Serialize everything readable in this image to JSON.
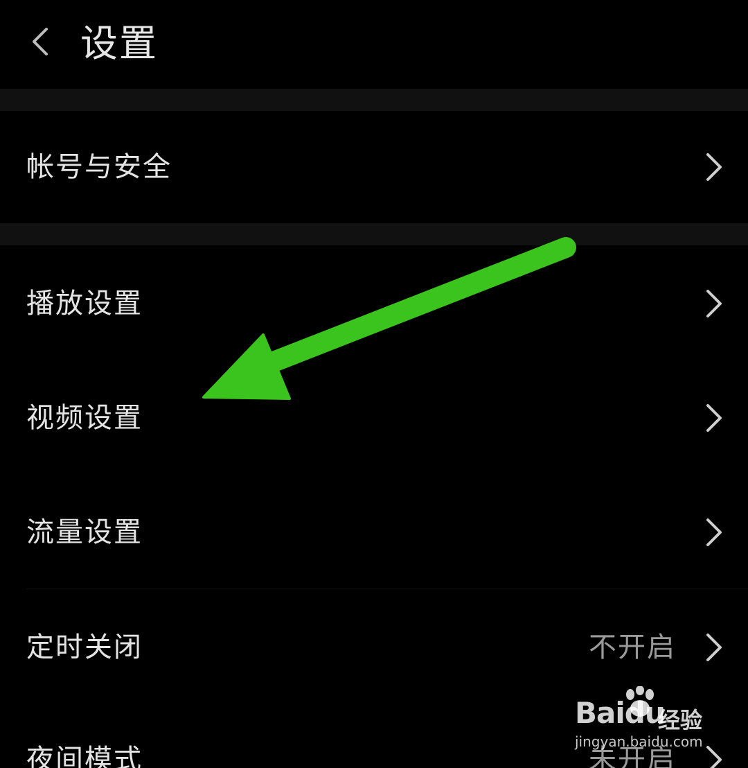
{
  "header": {
    "title": "设置",
    "back_icon": "chevron-left-icon"
  },
  "settings": {
    "account_security": {
      "label": "帐号与安全"
    },
    "playback": {
      "label": "播放设置"
    },
    "video": {
      "label": "视频设置"
    },
    "data_usage": {
      "label": "流量设置"
    },
    "sleep_timer": {
      "label": "定时关闭",
      "value": "不开启"
    },
    "night_mode": {
      "label": "夜间模式",
      "value": "未开启"
    }
  },
  "annotation": {
    "arrow_color": "#3cc41e",
    "points_to": "视频设置"
  },
  "watermark": {
    "brand_bai": "Bai",
    "brand_du": "du",
    "brand_suffix": "经验",
    "url": "jingyan.baidu.com"
  },
  "colors": {
    "background": "#000000",
    "divider": "#111111",
    "text": "#e4e4e4",
    "secondary_text": "#9a9a9a",
    "chevron": "#cfcfcf"
  }
}
